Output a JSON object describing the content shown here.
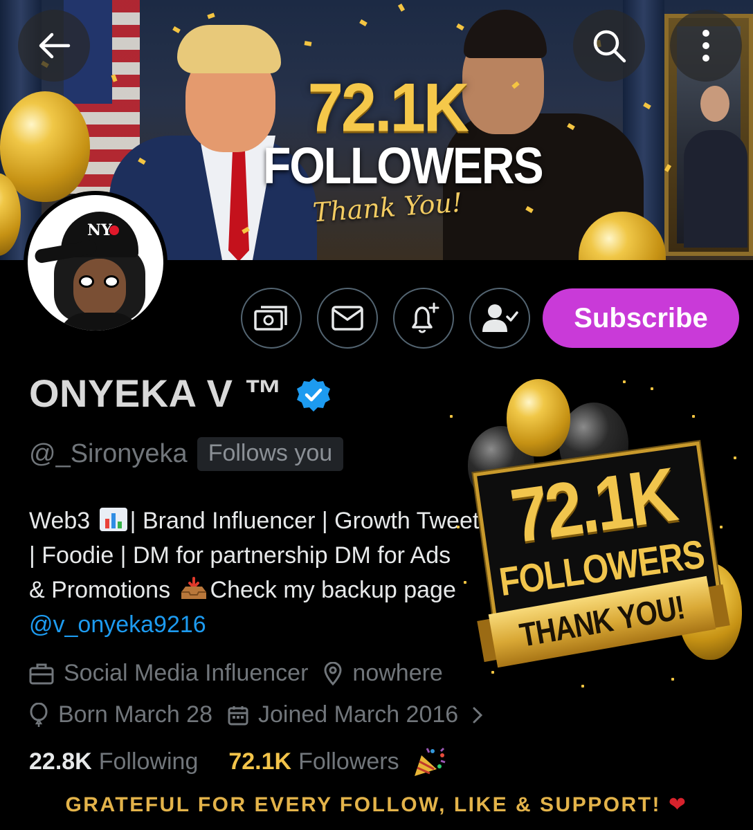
{
  "banner": {
    "count": "72.1K",
    "label": "FOLLOWERS",
    "thanks": "Thank You!"
  },
  "header": {
    "back_icon": "arrow-left-icon",
    "search_icon": "search-icon",
    "more_icon": "more-vertical-icon"
  },
  "actions": {
    "tip_icon": "money-icon",
    "message_icon": "envelope-icon",
    "notify_icon": "bell-plus-icon",
    "following_icon": "person-check-icon",
    "subscribe_label": "Subscribe",
    "subscribe_color": "#c93ad8"
  },
  "profile": {
    "name": "ONYEKA V ™",
    "handle": "@_Sironyeka",
    "follows_you": "Follows you",
    "bio": {
      "line1_a": "Web3",
      "line1_b": "| Brand Influencer | Growth Tweets",
      "line2": "| Foodie | DM for partnership DM for Ads",
      "line3_a": "& Promotions",
      "line3_b": "Check my backup page",
      "link": "@v_onyeka9216"
    },
    "profession": "Social Media Influencer",
    "location": "nowhere",
    "birthday": "Born March 28",
    "joined": "Joined March 2016"
  },
  "stats": {
    "following_count": "22.8K",
    "following_label": "Following",
    "followers_count": "72.1K",
    "followers_label": "Followers"
  },
  "celebration": {
    "count": "72.1K",
    "label": "FOLLOWERS",
    "ribbon": "THANK YOU!"
  },
  "footer": {
    "text": "GRATEFUL FOR EVERY FOLLOW, LIKE & SUPPORT!",
    "heart": "❤"
  },
  "colors": {
    "accent_gold": "#f3c44a",
    "link_blue": "#1d9bf0",
    "verified_blue": "#1d9bf0"
  }
}
